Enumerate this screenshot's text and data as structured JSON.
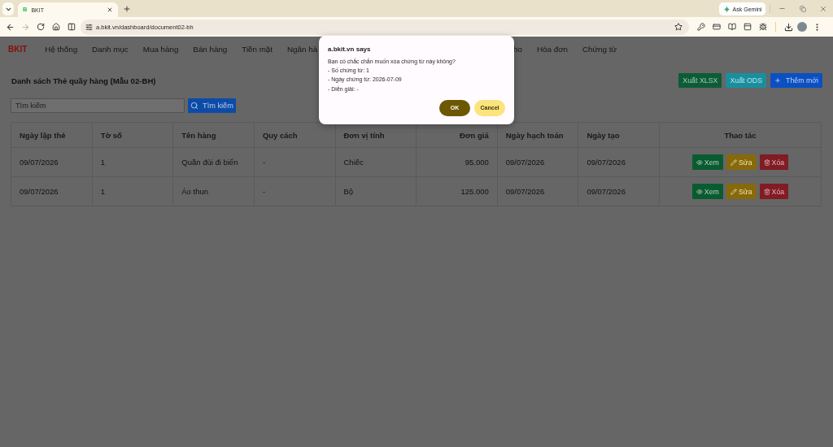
{
  "browser": {
    "tab": {
      "favicon": "B",
      "title": "BKIT"
    },
    "forward_disabled": true,
    "address": "a.bkit.vn/dashboard/document02-bh",
    "gemini": "Ask Gemini"
  },
  "nav": {
    "brand": "BKIT",
    "items": [
      "Hệ thống",
      "Danh mục",
      "Mua hàng",
      "Bán hàng",
      "Tiền mặt",
      "Ngân hà"
    ],
    "items_past_dialog": [
      "ho",
      "Hóa đơn",
      "Chứng từ"
    ]
  },
  "page": {
    "title": "Danh sách Thẻ quầy hàng (Mẫu 02-BH)",
    "actions": [
      {
        "kind": "xlsx",
        "label": "Xuất XLSX"
      },
      {
        "kind": "ods",
        "label": "Xuất ODS"
      },
      {
        "kind": "add",
        "label": "Thêm mới"
      }
    ]
  },
  "search": {
    "placeholder": "Tìm kiếm",
    "button": "Tìm kiếm"
  },
  "table": {
    "columns": [
      {
        "label": "Ngày lập thẻ",
        "kind": "text"
      },
      {
        "label": "Tờ số",
        "kind": "text"
      },
      {
        "label": "Tên hàng",
        "kind": "text"
      },
      {
        "label": "Quy cách",
        "kind": "text"
      },
      {
        "label": "Đơn vị tính",
        "kind": "text"
      },
      {
        "label": "Đơn giá",
        "kind": "number"
      },
      {
        "label": "Ngày hạch toán",
        "kind": "text"
      },
      {
        "label": "Ngày tạo",
        "kind": "text"
      },
      {
        "label": "Thao tác",
        "kind": "actions"
      }
    ],
    "rows": [
      {
        "cells": [
          "09/07/2026",
          "1",
          "Quần đùi đi biển",
          "-",
          "Chiếc",
          "95.000",
          "09/07/2026",
          "09/07/2026"
        ],
        "actions": [
          {
            "kind": "view",
            "label": "Xem"
          },
          {
            "kind": "edit",
            "label": "Sửa"
          },
          {
            "kind": "delete",
            "label": "Xóa"
          }
        ]
      },
      {
        "cells": [
          "09/07/2026",
          "1",
          "Áo thun",
          "-",
          "Bộ",
          "125.000",
          "09/07/2026",
          "09/07/2026"
        ],
        "actions": [
          {
            "kind": "view",
            "label": "Xem"
          },
          {
            "kind": "edit",
            "label": "Sửa"
          },
          {
            "kind": "delete",
            "label": "Xóa"
          }
        ]
      }
    ]
  },
  "dialog": {
    "title": "a.bkit.vn says",
    "lines": [
      "Bạn có chắc chắn muốn xóa chứng từ này không?",
      "- Số chứng từ: 1",
      "- Ngày chứng từ: 2026-07-09",
      "- Diễn giải: -"
    ],
    "buttons": [
      {
        "kind": "primary",
        "label": "OK"
      },
      {
        "kind": "secondary",
        "label": "Cancel"
      }
    ]
  }
}
